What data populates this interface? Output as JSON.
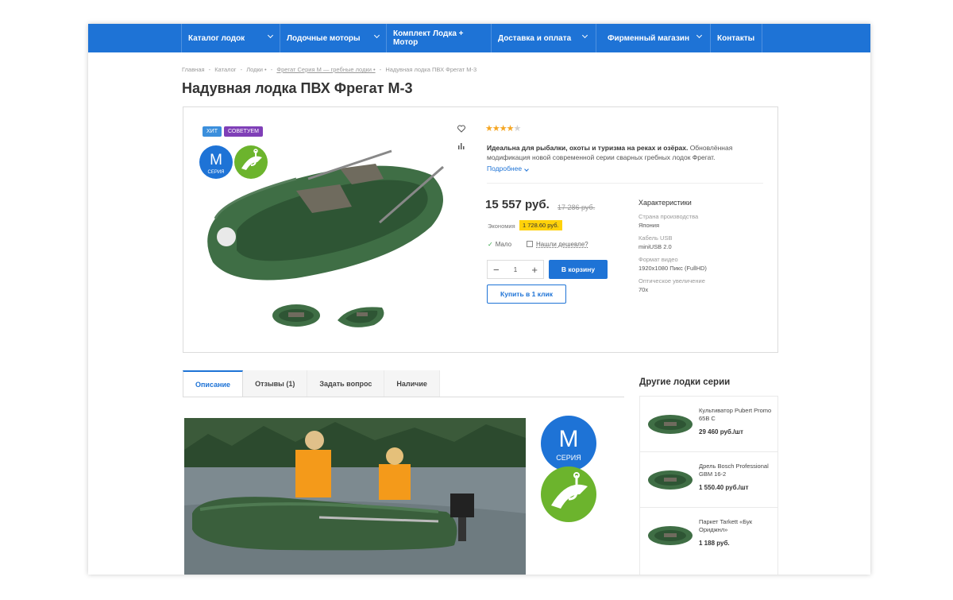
{
  "nav": {
    "items": [
      {
        "label": "Каталог лодок",
        "has_arrow": true
      },
      {
        "label": "Лодочные моторы",
        "has_arrow": true
      },
      {
        "label": "Комплект Лодка + Мотор",
        "has_arrow": false
      },
      {
        "label": "Доставка и оплата",
        "has_arrow": true
      },
      {
        "label": "Фирменный магазин",
        "has_arrow": true
      },
      {
        "label": "Контакты",
        "has_arrow": false
      }
    ]
  },
  "breadcrumbs": [
    "Главная",
    "-",
    "Каталог",
    "-",
    "Лодки •",
    "-",
    "Фрегат Серия М — гребные лодки •",
    "-",
    "Надувная лодка ПВХ Фрегат М-3"
  ],
  "product": {
    "title": "Надувная лодка ПВХ Фрегат М-3",
    "badges": {
      "hit": "ХИТ",
      "recommend": "СОВЕТУЕМ"
    },
    "series_logo": {
      "letter": "М",
      "word": "СЕРИЯ"
    },
    "rating": {
      "value": 4,
      "max": 5
    },
    "description_bold": "Идеальна для рыбалки, охоты и туризма на реках и озёрах.",
    "description": " Обновлённая модификация новой современной серии сварных гребных лодок Фрегат.",
    "more_link": "Подробнее",
    "price": "15 557 руб.",
    "old_price": "17 286 руб.",
    "economy_label": "Экономия",
    "economy_value": "1 728.60 руб.",
    "stock_label": "Мало",
    "cheaper_link": "Нашли дешевле?",
    "quantity": "1",
    "cart_button": "В корзину",
    "buy_one_click": "Купить в 1 клик",
    "characteristics_title": "Характеристики",
    "characteristics": [
      {
        "name": "Страна производства",
        "value": "Япония"
      },
      {
        "name": "Кабель USB",
        "value": "miniUSB 2.0"
      },
      {
        "name": "Формат видео",
        "value": "1920x1080 Пикс (FullHD)"
      },
      {
        "name": "Оптическое увеличение",
        "value": "70x"
      }
    ]
  },
  "tabs": [
    {
      "label": "Описание",
      "active": true
    },
    {
      "label": "Отзывы  (1)",
      "active": false
    },
    {
      "label": "Задать вопрос",
      "active": false
    },
    {
      "label": "Наличие",
      "active": false
    }
  ],
  "sidebar": {
    "title": "Другие лодки серии",
    "items": [
      {
        "name": "Культиватор Pubert Promo 65B C",
        "price": "29 460 руб./шт"
      },
      {
        "name": "Дрель Bosch Professional GBM 16-2",
        "price": "1 550.40 руб./шт"
      },
      {
        "name": "Паркет Tarkett «Бук Ориджнл»",
        "price": "1 188 руб."
      }
    ]
  },
  "colors": {
    "accent": "#1e73d6",
    "boat_green": "#3f6e45",
    "series_logo_blue": "#1e73d6",
    "series_logo_green": "#6cb42d",
    "badge_hit": "#3b8fdc",
    "badge_recommend": "#7f3fb7",
    "economy_highlight": "#ffd20a",
    "stars": "#f5a623"
  }
}
